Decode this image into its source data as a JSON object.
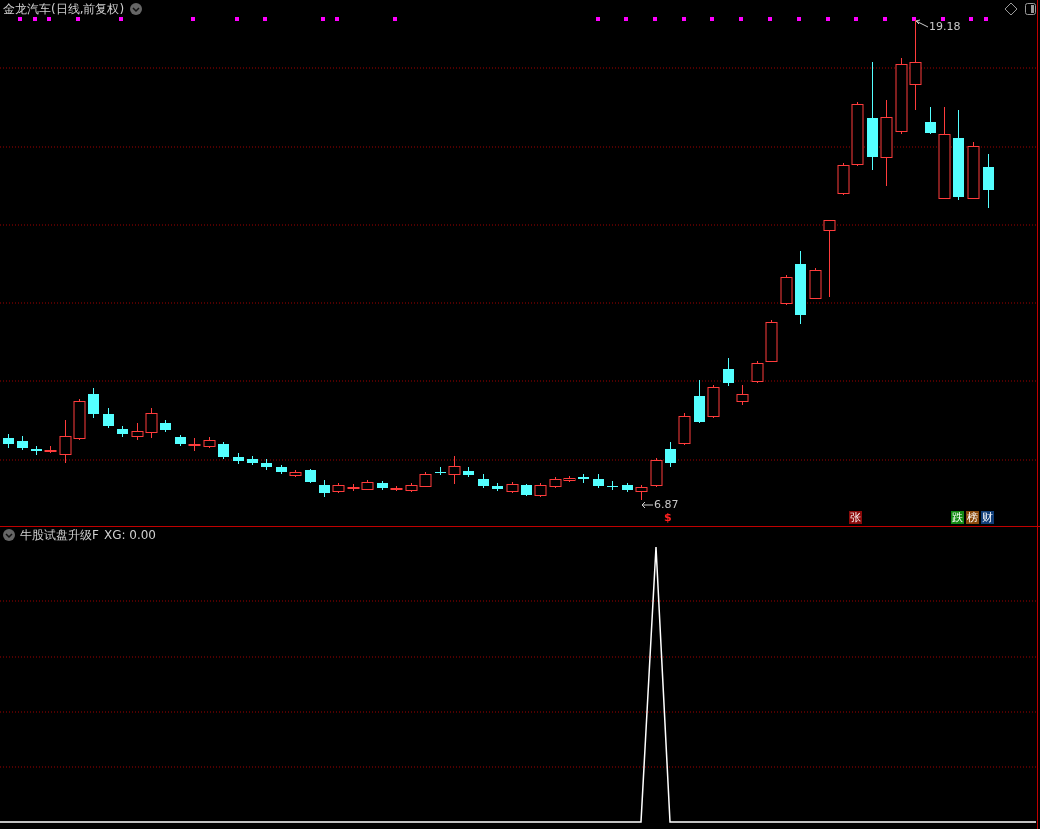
{
  "main_chart": {
    "title": "金龙汽车(日线,前复权)",
    "high_label": "19.18",
    "low_label": "6.87"
  },
  "event_marks": [
    {
      "kind": "dollar",
      "text": "$",
      "color": "#ff2020"
    },
    {
      "kind": "badge",
      "text": "张",
      "color": "#8b0a0a"
    },
    {
      "kind": "badge",
      "text": "跌",
      "color": "#138a13"
    },
    {
      "kind": "badge",
      "text": "榜",
      "color": "#8a4a0c"
    },
    {
      "kind": "badge",
      "text": "财",
      "color": "#103e78"
    }
  ],
  "indicator": {
    "title": "牛股试盘升级F",
    "reading": "XG: 0.00"
  }
}
